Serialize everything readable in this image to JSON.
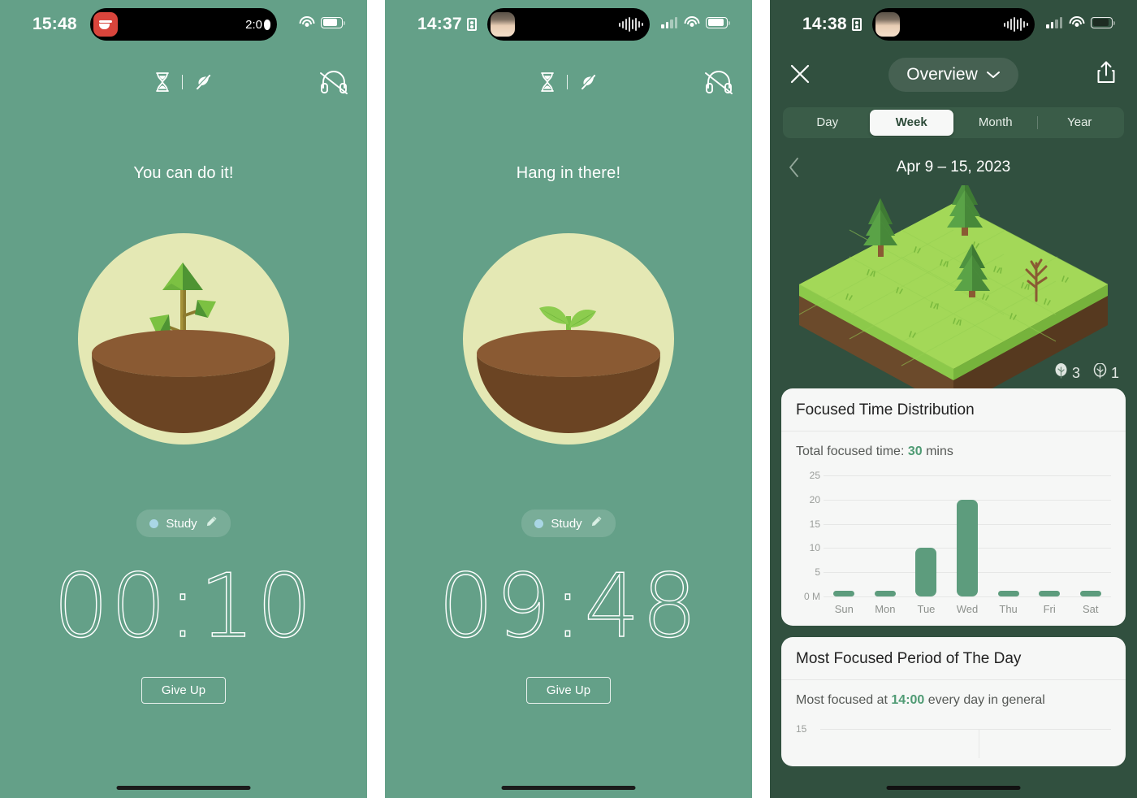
{
  "screens": [
    {
      "id": "timer-screen-1",
      "status_bar": {
        "time": "15:48",
        "island_right_text": "2:0",
        "island_app_icon": "coffee-cup-icon",
        "wifi": "wifi-icon",
        "battery": "battery-icon"
      },
      "top_icons": {
        "hourglass": "hourglass-icon",
        "leaf_off": "leaf-slash-icon",
        "headphones_off": "headphones-slash-icon"
      },
      "encouragement": "You can do it!",
      "plant": "sapling-with-branches",
      "tag": {
        "label": "Study",
        "dot_color": "#a9d6e5",
        "edit_icon": "pencil-icon"
      },
      "countdown": "00:10",
      "give_up_label": "Give Up"
    },
    {
      "id": "timer-screen-2",
      "status_bar": {
        "time": "14:37",
        "island_right_text": "",
        "island_app_icon": "photo-thumbnail-icon",
        "wifi": "wifi-icon",
        "battery": "battery-icon"
      },
      "top_icons": {
        "hourglass": "hourglass-icon",
        "leaf_off": "leaf-slash-icon",
        "headphones_off": "headphones-slash-icon"
      },
      "encouragement": "Hang in there!",
      "plant": "two-leaf-seedling",
      "tag": {
        "label": "Study",
        "dot_color": "#a9d6e5",
        "edit_icon": "pencil-icon"
      },
      "countdown": "09:48",
      "give_up_label": "Give Up"
    }
  ],
  "stats": {
    "status_bar": {
      "time": "14:38"
    },
    "nav": {
      "close_label": "",
      "title": "Overview",
      "chevron": "chevron-down-icon",
      "share": "share-icon"
    },
    "segments": [
      {
        "label": "Day",
        "active": false
      },
      {
        "label": "Week",
        "active": true
      },
      {
        "label": "Month",
        "active": false
      },
      {
        "label": "Year",
        "active": false
      }
    ],
    "date_range": "Apr 9 – 15, 2023",
    "forest": {
      "healthy_trees": "3",
      "withered_trees": "1"
    },
    "cards": [
      {
        "title": "Focused Time Distribution",
        "summary_prefix": "Total focused time: ",
        "summary_value": "30",
        "summary_suffix": " mins"
      },
      {
        "title": "Most Focused Period of The Day",
        "summary_prefix": "Most focused at ",
        "summary_value": "14:00",
        "summary_suffix": " every day in general",
        "y_top_label": "15"
      }
    ]
  },
  "chart_data": {
    "type": "bar",
    "title": "Focused Time Distribution",
    "categories": [
      "Sun",
      "Mon",
      "Tue",
      "Wed",
      "Thu",
      "Fri",
      "Sat"
    ],
    "values": [
      0,
      0,
      10,
      20,
      0,
      0,
      0
    ],
    "yticks": [
      "25",
      "20",
      "15",
      "10",
      "5",
      "0 M"
    ],
    "ytick_values": [
      25,
      20,
      15,
      10,
      5,
      0
    ],
    "ylim": [
      0,
      25
    ],
    "xlabel": "",
    "ylabel": "minutes",
    "grid": true,
    "legend": "none",
    "bar_color": "#5d9c7d",
    "total_focused_minutes": 30
  },
  "colors": {
    "timer_bg": "#64a088",
    "stats_bg": "#31503f",
    "accent_green": "#5d9c7d",
    "soil": "#6b4423",
    "plant_circle": "#e4e8b4"
  }
}
